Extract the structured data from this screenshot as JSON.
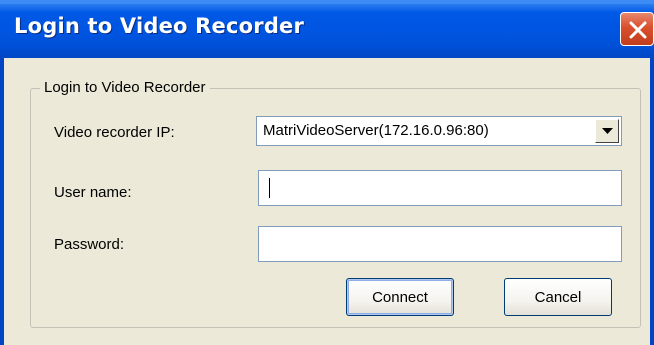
{
  "window": {
    "title": "Login to Video Recorder",
    "close_icon": "close-icon"
  },
  "group": {
    "legend": "Login to Video Recorder"
  },
  "form": {
    "ip_label": "Video recorder IP:",
    "ip_value": "MatriVideoServer(172.16.0.96:80)",
    "ip_dropdown_icon": "chevron-down-icon",
    "username_label": "User name:",
    "username_value": "",
    "password_label": "Password:",
    "password_value": ""
  },
  "buttons": {
    "connect_label": "Connect",
    "cancel_label": "Cancel"
  },
  "colors": {
    "titlebar": "#0055E5",
    "close_button": "#D9502E",
    "dialog_background": "#ECE9D8",
    "field_border": "#7F9DB9"
  }
}
